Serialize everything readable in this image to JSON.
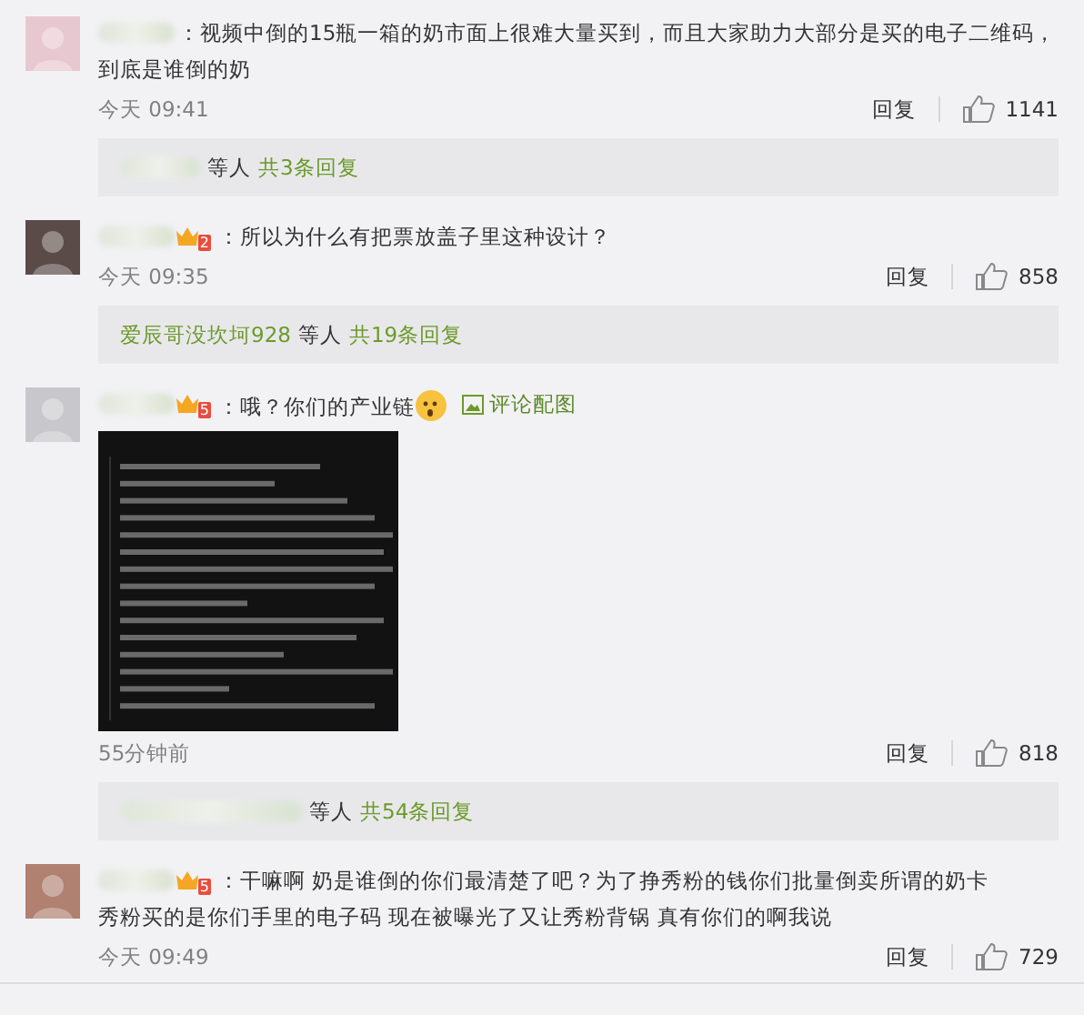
{
  "comments": [
    {
      "content": [
        {
          "kind": "text",
          "text": "：视频中倒的15瓶一箱的奶市面上很难大量买到，而且大家助力大部分是买的电子二维码，"
        },
        {
          "kind": "text",
          "text": "到底是谁倒的奶"
        }
      ],
      "time": "今天 09:41",
      "reply_label": "回复",
      "likes": "1141",
      "replies": {
        "suffix": "等人",
        "count": "共3条回复"
      }
    },
    {
      "badge_level": "2",
      "content": [
        {
          "kind": "text",
          "text": "：所以为什么有把票放盖子里这种设计？"
        }
      ],
      "time": "今天 09:35",
      "reply_label": "回复",
      "likes": "858",
      "replies": {
        "name": "爱辰哥没坎坷928",
        "suffix": "等人",
        "count": "共19条回复"
      }
    },
    {
      "badge_level": "5",
      "content": [
        {
          "kind": "text",
          "text": "：哦？你们的产业链"
        },
        {
          "kind": "emoji"
        },
        {
          "kind": "link",
          "text": "评论配图"
        }
      ],
      "attachment": {
        "kind": "picture"
      },
      "time": "55分钟前",
      "reply_label": "回复",
      "likes": "818",
      "replies": {
        "suffix": "等人",
        "count": "共54条回复"
      }
    },
    {
      "badge_level": "5",
      "content": [
        {
          "kind": "text",
          "text": "：干嘛啊 奶是谁倒的你们最清楚了吧？为了挣秀粉的钱你们批量倒卖所谓的奶卡"
        },
        {
          "kind": "text",
          "text": "秀粉买的是你们手里的电子码 现在被曝光了又让秀粉背锅 真有你们的啊我说"
        }
      ],
      "time": "今天 09:49",
      "reply_label": "回复",
      "likes": "729"
    }
  ]
}
